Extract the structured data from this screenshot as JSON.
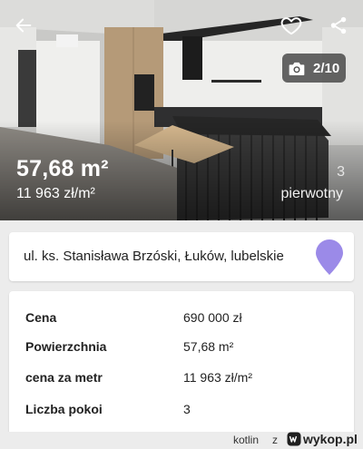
{
  "listing": {
    "area": "57,68 m²",
    "price_per_m2": "11 963 zł/m²",
    "rooms": "3",
    "market": "pierwotny",
    "photo_counter": "2/10"
  },
  "address": {
    "text": "ul. ks. Stanisława Brzóski, Łuków, lubelskie"
  },
  "details": [
    {
      "label": "Cena",
      "value": "690 000 zł"
    },
    {
      "label": "Powierzchnia",
      "value": "57,68 m²"
    },
    {
      "label": "cena za metr",
      "value": "11 963 zł/m²"
    },
    {
      "label": "Liczba pokoi",
      "value": "3"
    }
  ],
  "footer": {
    "author": "kotlin",
    "separator": "z",
    "site": "wykop.pl"
  },
  "icons": {
    "back": "arrow-left-icon",
    "favorite": "heart-outline-icon",
    "share": "share-icon",
    "camera": "camera-icon",
    "location": "map-pin-icon",
    "site_logo": "wykop-logo-icon"
  },
  "colors": {
    "pin": "#9b8ae8",
    "overlay_text": "#ffffff",
    "card_bg": "#ffffff",
    "page_bg": "#ececec"
  }
}
